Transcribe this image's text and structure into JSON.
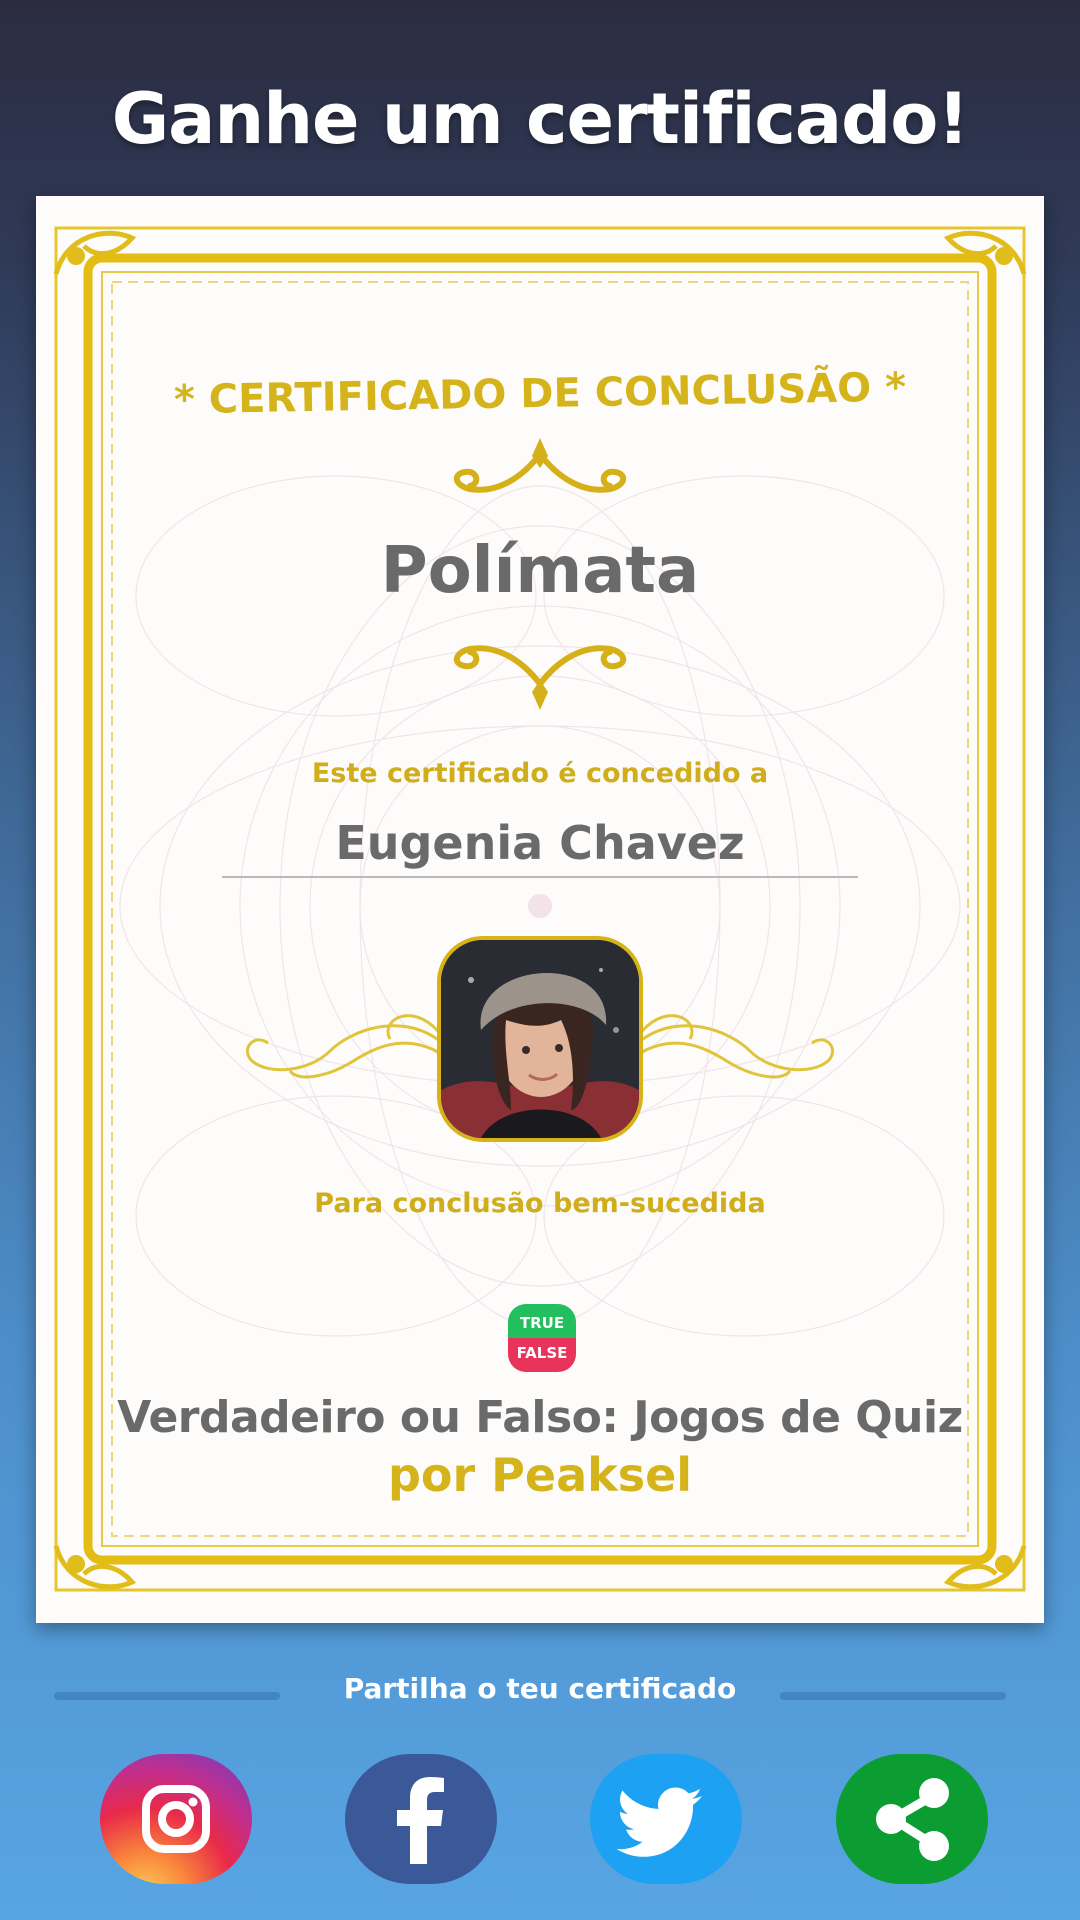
{
  "header": {
    "title": "Ganhe um certificado!"
  },
  "certificate": {
    "heading": "* CERTIFICADO DE CONCLUSÃO *",
    "achievement": "Polímata",
    "awarded_to_label": "Este certificado é concedido a",
    "recipient_name": "Eugenia Chavez",
    "completion_label": "Para conclusão bem-sucedida",
    "app_logo": {
      "top": "TRUE",
      "bottom": "FALSE"
    },
    "app_name": "Verdadeiro ou Falso: Jogos de Quiz",
    "publisher": "por Peaksel"
  },
  "share": {
    "label": "Partilha o teu certificado",
    "buttons": [
      {
        "name": "instagram",
        "icon": "instagram-icon"
      },
      {
        "name": "facebook",
        "icon": "facebook-icon"
      },
      {
        "name": "twitter",
        "icon": "twitter-icon"
      },
      {
        "name": "share",
        "icon": "share-icon"
      }
    ]
  },
  "colors": {
    "gold": "#d4b41a",
    "gray_text": "#6a6a6a",
    "instagram": "#e8294a",
    "facebook": "#3b5998",
    "twitter": "#1da1f2",
    "share": "#0b9d32",
    "logo_true": "#23bf5f",
    "logo_false": "#e8335a"
  }
}
